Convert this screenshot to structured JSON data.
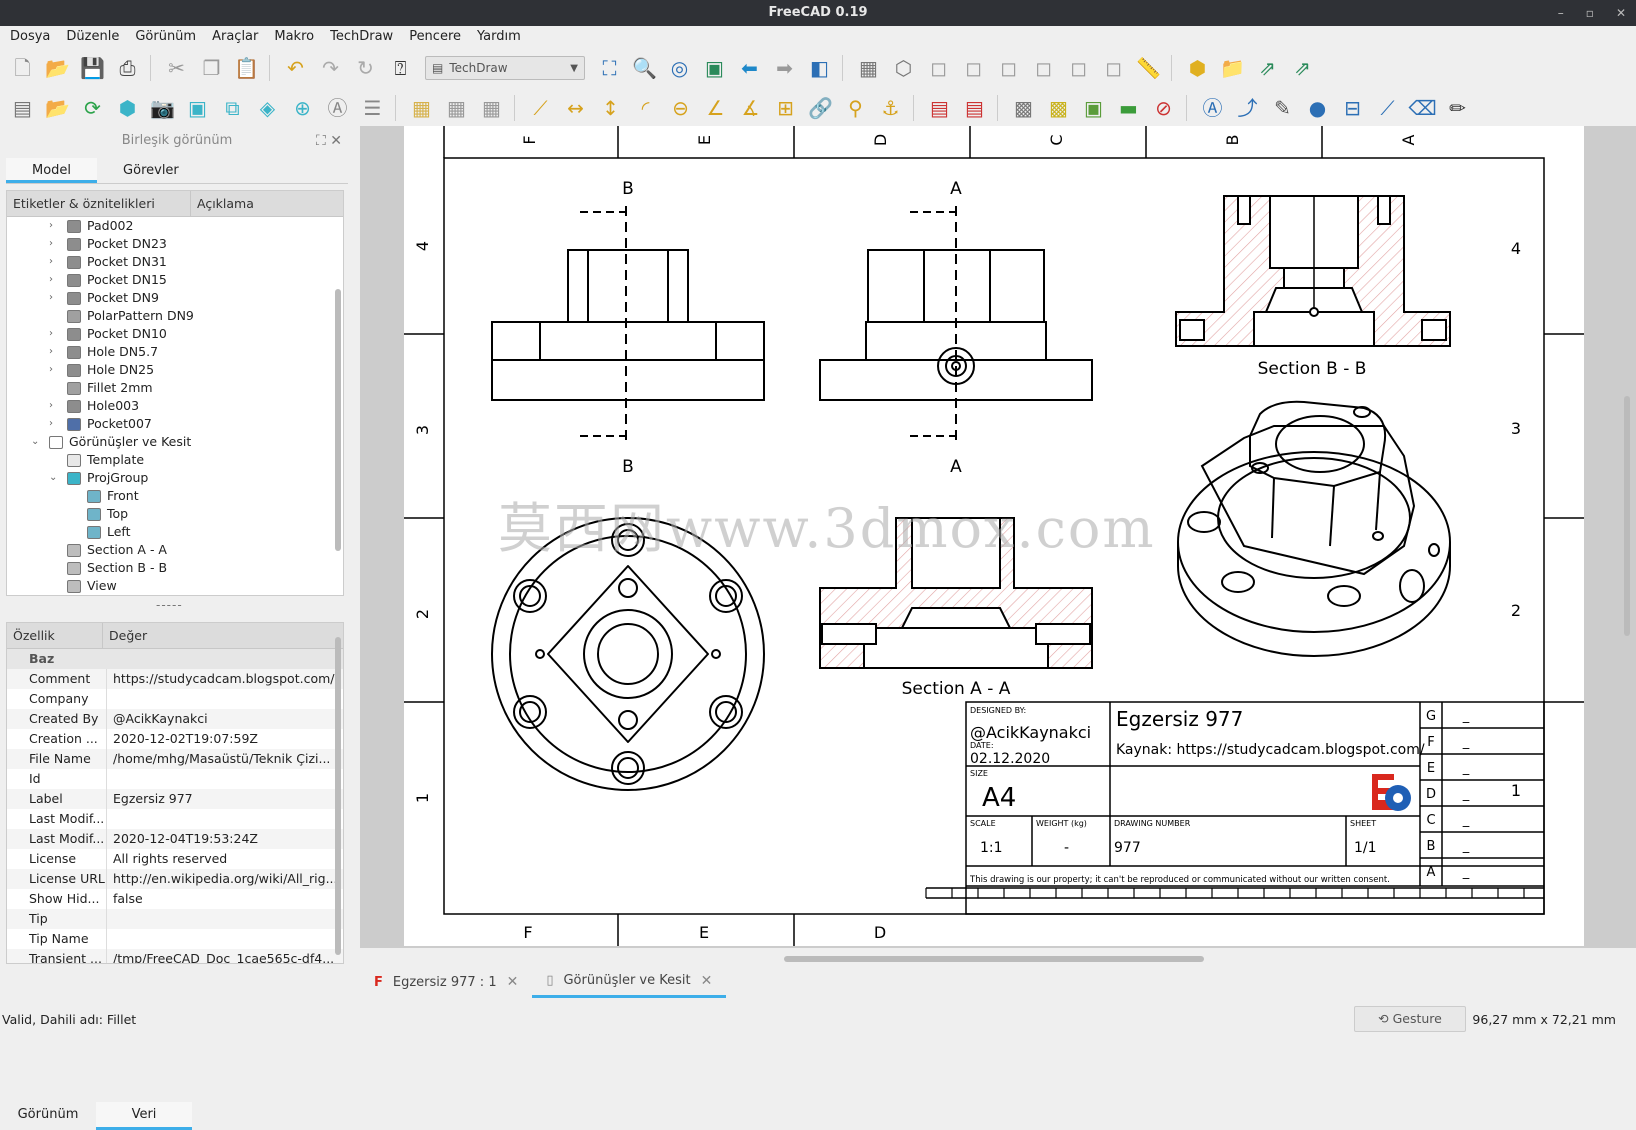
{
  "window": {
    "title": "FreeCAD 0.19"
  },
  "menu": [
    "Dosya",
    "Düzenle",
    "Görünüm",
    "Araçlar",
    "Makro",
    "TechDraw",
    "Pencere",
    "Yardım"
  ],
  "toolbar": {
    "workbench": "TechDraw"
  },
  "combo": {
    "header": "Birleşik görünüm",
    "tabs": [
      "Model",
      "Görevler"
    ],
    "tree_columns": [
      "Etiketler & öznitelikleri",
      "Açıklama"
    ],
    "tree": [
      {
        "label": "Pad002",
        "level": 2,
        "arrow": "›",
        "icon": "#8d8d8d"
      },
      {
        "label": "Pocket DN23",
        "level": 2,
        "arrow": "›",
        "icon": "#8d8d8d"
      },
      {
        "label": "Pocket DN31",
        "level": 2,
        "arrow": "›",
        "icon": "#8d8d8d"
      },
      {
        "label": "Pocket DN15",
        "level": 2,
        "arrow": "›",
        "icon": "#8d8d8d"
      },
      {
        "label": "Pocket DN9",
        "level": 2,
        "arrow": "›",
        "icon": "#8d8d8d"
      },
      {
        "label": "PolarPattern DN9",
        "level": 2,
        "arrow": "",
        "icon": "#a0a0a0"
      },
      {
        "label": "Pocket DN10",
        "level": 2,
        "arrow": "›",
        "icon": "#8d8d8d"
      },
      {
        "label": "Hole DN5.7",
        "level": 2,
        "arrow": "›",
        "icon": "#8d8d8d"
      },
      {
        "label": "Hole DN25",
        "level": 2,
        "arrow": "›",
        "icon": "#8d8d8d"
      },
      {
        "label": "Fillet 2mm",
        "level": 2,
        "arrow": "",
        "icon": "#a0a0a0"
      },
      {
        "label": "Hole003",
        "level": 2,
        "arrow": "›",
        "icon": "#8d8d8d"
      },
      {
        "label": "Pocket007",
        "level": 2,
        "arrow": "›",
        "icon": "#4f6fa8"
      },
      {
        "label": "Görünüşler ve Kesit",
        "level": 1,
        "arrow": "⌄",
        "icon": "#ffffff"
      },
      {
        "label": "Template",
        "level": 2,
        "arrow": "",
        "icon": "#e8e8e8"
      },
      {
        "label": "ProjGroup",
        "level": 2,
        "arrow": "⌄",
        "icon": "#3bb4c8"
      },
      {
        "label": "Front",
        "level": 3,
        "arrow": "",
        "icon": "#6fb4c9"
      },
      {
        "label": "Top",
        "level": 3,
        "arrow": "",
        "icon": "#6fb4c9"
      },
      {
        "label": "Left",
        "level": 3,
        "arrow": "",
        "icon": "#6fb4c9"
      },
      {
        "label": "Section A - A",
        "level": 2,
        "arrow": "",
        "icon": "#bdbdbd"
      },
      {
        "label": "Section B - B",
        "level": 2,
        "arrow": "",
        "icon": "#bdbdbd"
      },
      {
        "label": "View",
        "level": 2,
        "arrow": "",
        "icon": "#bdbdbd"
      }
    ],
    "splitter": "-----",
    "prop_columns": [
      "Özellik",
      "Değer"
    ],
    "prop_group": "Baz",
    "properties": [
      {
        "k": "Comment",
        "v": "https://studycadcam.blogspot.com/"
      },
      {
        "k": "Company",
        "v": ""
      },
      {
        "k": "Created By",
        "v": "@AcikKaynakci"
      },
      {
        "k": "Creation ...",
        "v": "2020-12-02T19:07:59Z"
      },
      {
        "k": "File Name",
        "v": "/home/mhg/Masaüstü/Teknik Çizi..."
      },
      {
        "k": "Id",
        "v": ""
      },
      {
        "k": "Label",
        "v": "Egzersiz 977"
      },
      {
        "k": "Last Modif...",
        "v": ""
      },
      {
        "k": "Last Modif...",
        "v": "2020-12-04T19:53:24Z"
      },
      {
        "k": "License",
        "v": "All rights reserved"
      },
      {
        "k": "License URL",
        "v": "http://en.wikipedia.org/wiki/All_rig..."
      },
      {
        "k": "Show Hid...",
        "v": "false"
      },
      {
        "k": "Tip",
        "v": ""
      },
      {
        "k": "Tip Name",
        "v": ""
      },
      {
        "k": "Transient ...",
        "v": "/tmp/FreeCAD_Doc_1cae565c-df4..."
      }
    ],
    "bottom_tabs": [
      "Görünüm",
      "Veri"
    ]
  },
  "drawing": {
    "col_labels": [
      "F",
      "E",
      "D",
      "C",
      "B",
      "A"
    ],
    "row_labels": [
      "4",
      "3",
      "2",
      "1"
    ],
    "view_labels": {
      "b1": "B",
      "a1": "A",
      "b2": "B",
      "a2": "A",
      "sec_bb": "Section B - B",
      "sec_aa": "Section A - A"
    },
    "watermark": "莫西网www.3dmox.com",
    "title_block": {
      "designed_by_label": "DESIGNED BY:",
      "designed_by": "@AcikKaynakci",
      "date_label": "DATE:",
      "date": "02.12.2020",
      "title": "Egzersiz 977",
      "source": "Kaynak: https://studycadcam.blogspot.com/",
      "size_label": "SIZE",
      "size": "A4",
      "scale_label": "SCALE",
      "scale": "1:1",
      "weight_label": "WEIGHT (kg)",
      "weight": "-",
      "drawing_number_label": "DRAWING NUMBER",
      "drawing_number": "977",
      "sheet_label": "SHEET",
      "sheet": "1/1",
      "footer": "This drawing is our property; it can't be reproduced or communicated without our written consent.",
      "revisions": [
        "G",
        "F",
        "E",
        "D",
        "C",
        "B",
        "A"
      ],
      "rev_value": "_"
    }
  },
  "doc_tabs": [
    {
      "label": "Egzersiz 977 : 1"
    },
    {
      "label": "Görünüşler ve Kesit"
    }
  ],
  "status": {
    "left": "Valid, Dahili adı: Fillet",
    "gesture": "Gesture",
    "coords": "96,27 mm x 72,21 mm"
  }
}
